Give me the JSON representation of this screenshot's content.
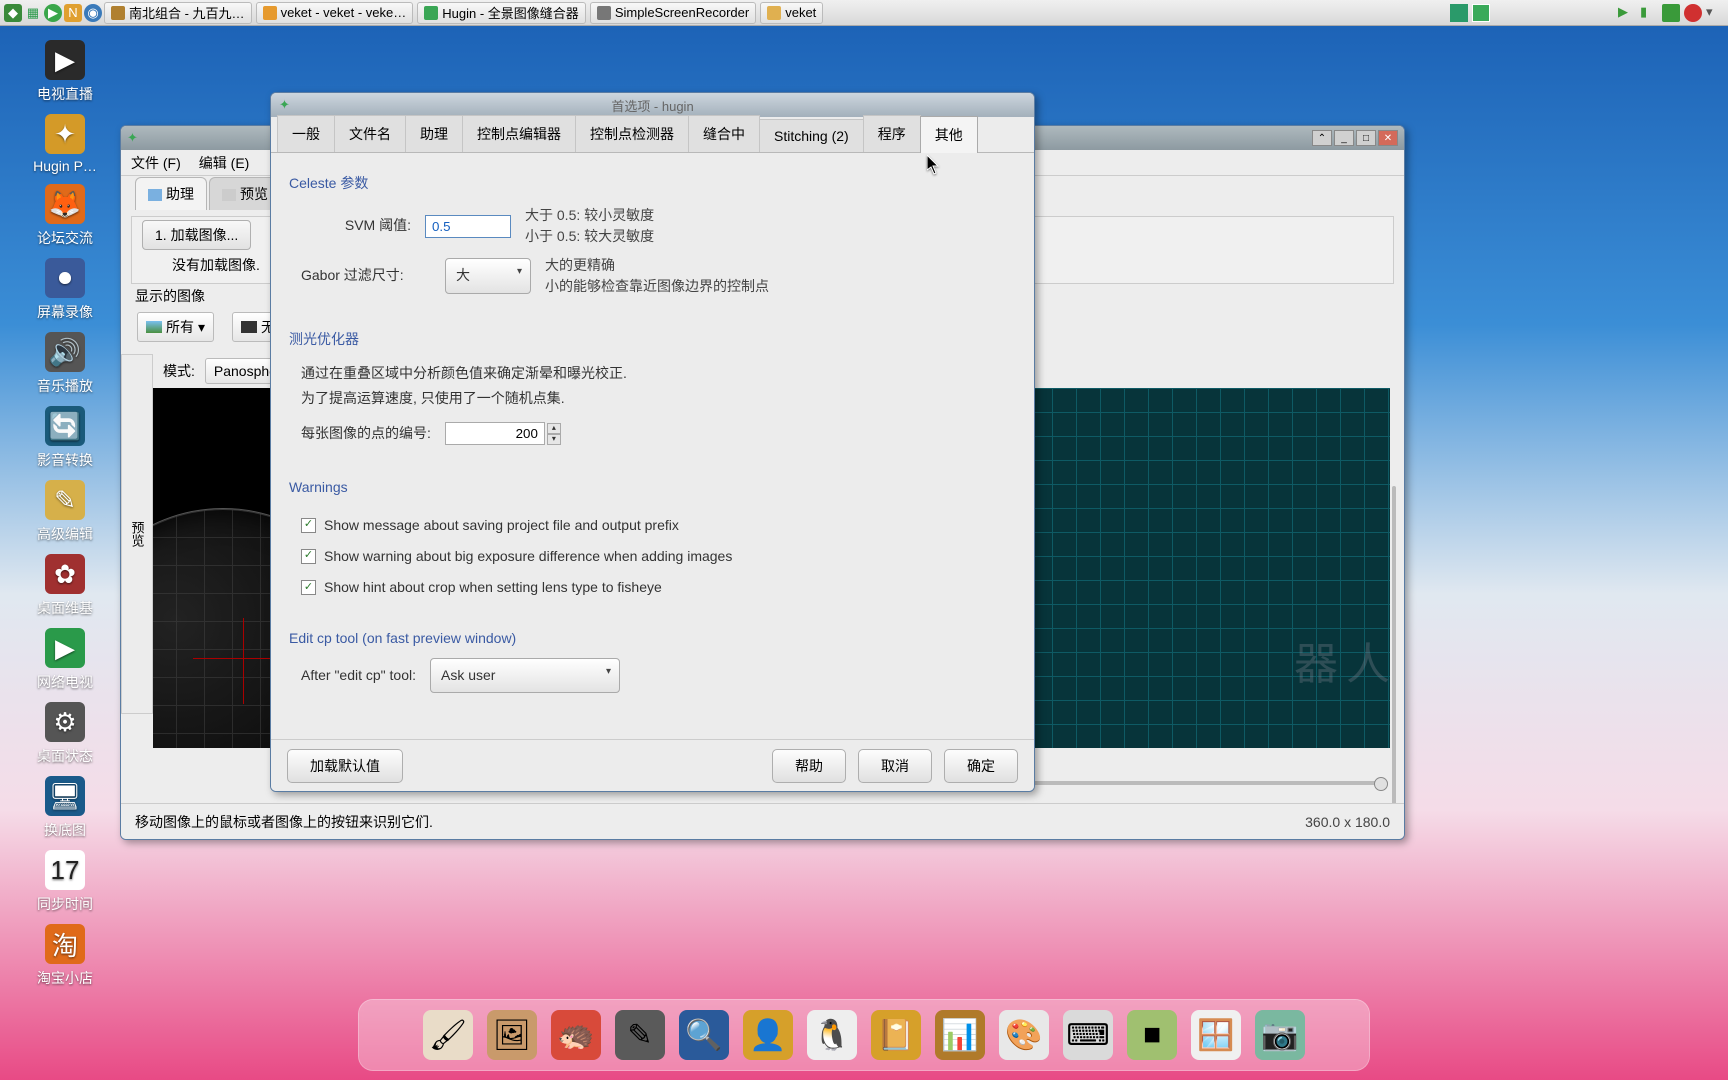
{
  "taskbar": {
    "items": [
      {
        "label": "南北组合 - 九百九…",
        "ico": "#b08030"
      },
      {
        "label": "veket - veket - veke…",
        "ico": "#e69a2e"
      },
      {
        "label": "Hugin - 全景图像缝合器",
        "ico": "#3aa655"
      },
      {
        "label": "SimpleScreenRecorder",
        "ico": "#777"
      },
      {
        "label": "veket",
        "ico": "#e0b050"
      }
    ]
  },
  "desktop": [
    {
      "label": "电视直播",
      "bg": "#2a2a2a",
      "glyph": "▶"
    },
    {
      "label": "Hugin P…",
      "bg": "#d49a28",
      "glyph": "✦"
    },
    {
      "label": "论坛交流",
      "bg": "#e06a1a",
      "glyph": "🦊"
    },
    {
      "label": "屏幕录像",
      "bg": "#3a5a9a",
      "glyph": "⏺"
    },
    {
      "label": "音乐播放",
      "bg": "#555",
      "glyph": "🔊"
    },
    {
      "label": "影音转换",
      "bg": "#1a5a7a",
      "glyph": "🔄"
    },
    {
      "label": "高级编辑",
      "bg": "#d6b04a",
      "glyph": "✎"
    },
    {
      "label": "桌面维基",
      "bg": "#a03030",
      "glyph": "✿"
    },
    {
      "label": "网络电视",
      "bg": "#2a9a4a",
      "glyph": "▶"
    },
    {
      "label": "桌面状态",
      "bg": "#555",
      "glyph": "⚙"
    },
    {
      "label": "换底图",
      "bg": "#1a5a8a",
      "glyph": "🖥"
    },
    {
      "label": "同步时间",
      "bg": "#fff",
      "glyph": "17",
      "txtcolor": "#222"
    },
    {
      "label": "淘宝小店",
      "bg": "#e06a1a",
      "glyph": "淘"
    }
  ],
  "bg_window": {
    "menu": {
      "file": "文件 (F)",
      "edit": "编辑 (E)"
    },
    "tabs": {
      "assistant": "助理",
      "preview": "预览"
    },
    "active_tab": "assistant",
    "load_btn": "1. 加载图像...",
    "no_load_msg": "没有加载图像.",
    "displayed": "显示的图像",
    "all": "所有",
    "none": "无",
    "preview_lbl": "预览",
    "mode_lbl": "模式:",
    "mode_val": "Panosphere",
    "footer_hint": "移动图像上的鼠标或者图像上的按钮来识别它们.",
    "dims": "360.0 x 180.0"
  },
  "prefs": {
    "title": "首选项 - hugin",
    "tabs": [
      "一般",
      "文件名",
      "助理",
      "控制点编辑器",
      "控制点检测器",
      "缝合中",
      "Stitching (2)",
      "程序",
      "其他"
    ],
    "active_tab": 8,
    "celeste": {
      "title": "Celeste 参数",
      "svm_label": "SVM 阈值:",
      "svm_value": "0.5",
      "svm_hint1": "大于 0.5: 较小灵敏度",
      "svm_hint2": "小于 0.5: 较大灵敏度",
      "gabor_label": "Gabor 过滤尺寸:",
      "gabor_value": "大",
      "gabor_hint1": "大的更精确",
      "gabor_hint2": "小的能够检查靠近图像边界的控制点"
    },
    "photometric": {
      "title": "测光优化器",
      "desc1": "通过在重叠区域中分析颜色值来确定渐晕和曝光校正.",
      "desc2": "为了提高运算速度, 只使用了一个随机点集.",
      "points_lbl": "每张图像的点的编号:",
      "points_val": "200"
    },
    "warnings": {
      "title": "Warnings",
      "c1": "Show message about saving project file and output prefix",
      "c2": "Show warning about big exposure difference when adding images",
      "c3": "Show hint about crop when setting lens type to fisheye"
    },
    "editcp": {
      "title": "Edit cp tool (on fast preview window)",
      "after_lbl": "After \"edit cp\" tool:",
      "after_val": "Ask user"
    },
    "buttons": {
      "defaults": "加载默认值",
      "help": "帮助",
      "cancel": "取消",
      "ok": "确定"
    }
  },
  "mini_window_title": "veket",
  "dock_icons": [
    {
      "bg": "#e9dcc8",
      "glyph": "🖌"
    },
    {
      "bg": "#c99a6b",
      "glyph": "🖼"
    },
    {
      "bg": "#d84a3a",
      "glyph": "🦔"
    },
    {
      "bg": "#5a5a5a",
      "glyph": "✎"
    },
    {
      "bg": "#2a5a9a",
      "glyph": "🔍"
    },
    {
      "bg": "#d6a02a",
      "glyph": "👤"
    },
    {
      "bg": "#eee",
      "glyph": "🐧"
    },
    {
      "bg": "#d6a02a",
      "glyph": "📔"
    },
    {
      "bg": "#b07a2a",
      "glyph": "📊"
    },
    {
      "bg": "#e8e8e8",
      "glyph": "🎨"
    },
    {
      "bg": "#dadada",
      "glyph": "⌨"
    },
    {
      "bg": "#a0c070",
      "glyph": "■"
    },
    {
      "bg": "#f0f0f0",
      "glyph": "🪟"
    },
    {
      "bg": "#7ab8a0",
      "glyph": "📷"
    }
  ],
  "watermark": "器人"
}
